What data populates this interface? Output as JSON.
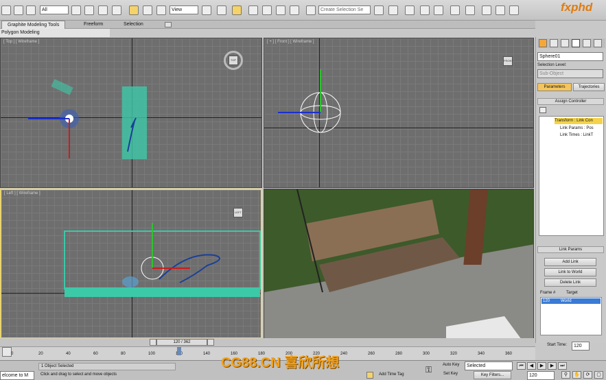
{
  "toolbar": {
    "selection_filter": "All",
    "reference_coord": "View",
    "named_selection_placeholder": "Create Selection Se",
    "brand": "fxphd"
  },
  "ribbon": {
    "tabs": [
      "Graphite Modeling Tools",
      "Freeform",
      "Selection"
    ],
    "sub_tab": "Polygon Modeling"
  },
  "viewports": {
    "top": "[ Top ] [ Wireframe ]",
    "front": "[ + ] [ Front ] [ Wireframe ]",
    "left": "[ Left ] [ Wireframe ]",
    "viewcube_top": "TOP",
    "viewcube_front": "FRONT",
    "viewcube_left": "LEFT"
  },
  "command_panel": {
    "object_name": "Sphere01",
    "selection_level_label": "Selection Level:",
    "sub_object": "Sub-Object",
    "tab_parameters": "Parameters",
    "tab_trajectories": "Trajectories",
    "assign_controller": "Assign Controller",
    "tree": [
      "Transform : Link Con",
      "Link Params : Pos",
      "Link Times : LinkT"
    ],
    "link_params": "Link Params",
    "add_link": "Add Link",
    "link_to_world": "Link to World",
    "delete_link": "Delete Link",
    "frame_header": "Frame #",
    "target_header": "Target",
    "frame_row": "120",
    "target_row": "World",
    "start_time_label": "Start Time:",
    "start_time_value": "120"
  },
  "timeline": {
    "slider": "120 / 362",
    "ticks": [
      "0",
      "20",
      "40",
      "60",
      "80",
      "100",
      "120",
      "140",
      "160",
      "180",
      "200",
      "220",
      "240",
      "260",
      "280",
      "300",
      "320",
      "340",
      "360"
    ]
  },
  "status": {
    "script": "elcome to M",
    "selected": "1 Object Selected",
    "prompt": "Click and drag to select and move objects",
    "add_time_tag": "Add Time Tag",
    "auto_key": "Auto Key",
    "set_key": "Set Key",
    "key_mode": "Selected",
    "key_filters": "Key Filters...",
    "frame": "120"
  },
  "watermark": "CG88.CN 喜欣所想",
  "colors": {
    "accent": "#e07c10",
    "active_viewport": "#e8d470",
    "selected_row": "#3a7bd5"
  }
}
